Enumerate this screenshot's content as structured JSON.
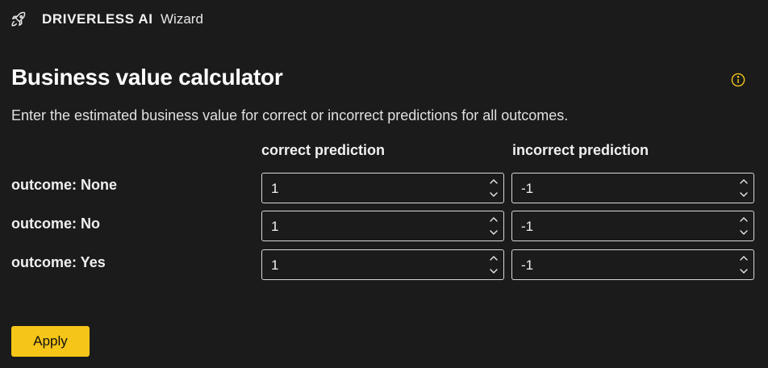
{
  "header": {
    "brand": "DRIVERLESS AI",
    "section": "Wizard",
    "logo_icon": "rocket-icon"
  },
  "page": {
    "title": "Business value calculator",
    "description": "Enter the estimated business value for correct or incorrect predictions for all outcomes.",
    "info_icon": "info-icon"
  },
  "columns": {
    "correct": "correct prediction",
    "incorrect": "incorrect prediction"
  },
  "rows": [
    {
      "label": "outcome: None",
      "correct": "1",
      "incorrect": "-1"
    },
    {
      "label": "outcome: No",
      "correct": "1",
      "incorrect": "-1"
    },
    {
      "label": "outcome: Yes",
      "correct": "1",
      "incorrect": "-1"
    }
  ],
  "actions": {
    "apply_label": "Apply"
  },
  "colors": {
    "background": "#1b1b1b",
    "accent": "#f5c518",
    "info_icon": "#f5c518"
  }
}
